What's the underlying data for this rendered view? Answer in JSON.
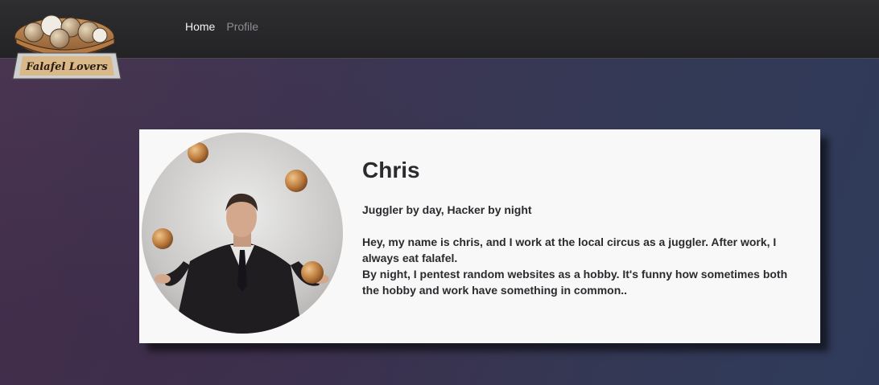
{
  "logo": {
    "text": "Falafel Lovers"
  },
  "nav": {
    "items": [
      {
        "label": "Home"
      },
      {
        "label": "Profile"
      }
    ]
  },
  "profile": {
    "name": "Chris",
    "tagline": "Juggler by day, Hacker by night",
    "bio_line1": "Hey, my name is chris, and I work at the local circus as a juggler. After work, I always eat falafel.",
    "bio_line2": "By night, I pentest random websites as a hobby. It's funny how sometimes both the hobby and work have something in common.."
  },
  "colors": {
    "navbar": "#262629",
    "card": "#f8f8f8",
    "text": "#2b2b2f",
    "nav_active": "#f2f2f2",
    "nav_inactive": "#8d8d93"
  }
}
